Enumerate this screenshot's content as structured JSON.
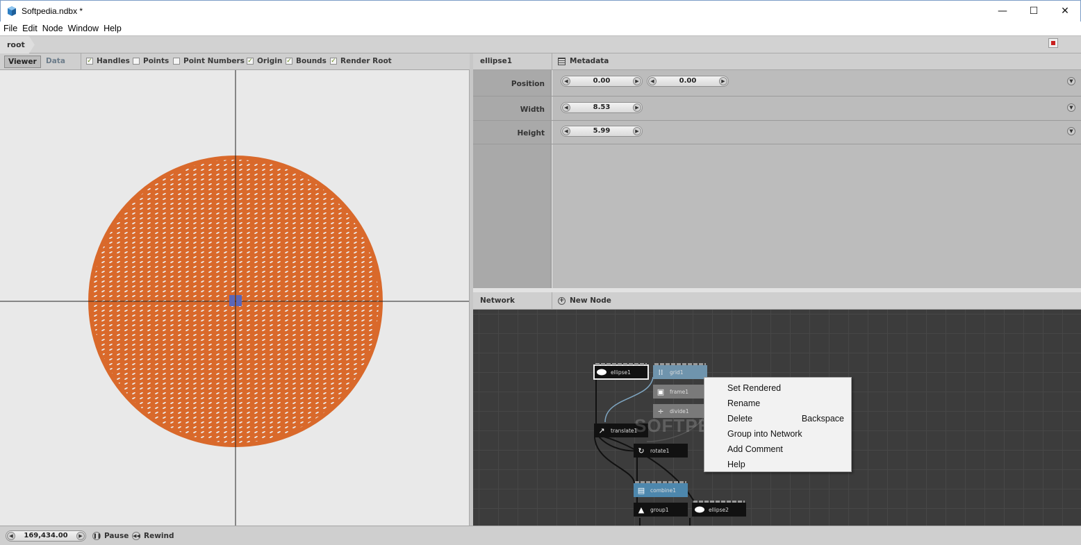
{
  "window": {
    "title": "Softpedia.ndbx *",
    "minimize": "—",
    "maximize": "☐",
    "close": "✕"
  },
  "menu": [
    "File",
    "Edit",
    "Node",
    "Window",
    "Help"
  ],
  "breadcrumb": {
    "root": "root"
  },
  "viewer": {
    "tabs": {
      "viewer": "Viewer",
      "data": "Data"
    },
    "options": [
      {
        "label": "Handles",
        "checked": true
      },
      {
        "label": "Points",
        "checked": false
      },
      {
        "label": "Point Numbers",
        "checked": false
      },
      {
        "label": "Origin",
        "checked": true
      },
      {
        "label": "Bounds",
        "checked": true
      },
      {
        "label": "Render Root",
        "checked": true
      }
    ],
    "shape_color": "#d9692b",
    "handle_color": "#5a66b8"
  },
  "parameters": {
    "node_name": "ellipse1",
    "metadata_label": "Metadata",
    "rows": [
      {
        "label": "Position",
        "values": [
          "0.00",
          "0.00"
        ]
      },
      {
        "label": "Width",
        "values": [
          "8.53"
        ]
      },
      {
        "label": "Height",
        "values": [
          "5.99"
        ]
      }
    ]
  },
  "network": {
    "title": "Network",
    "new_node": "New Node",
    "watermark": "SOFTPEDIA",
    "nodes": {
      "ellipse1": "ellipse1",
      "grid1": "grid1",
      "frame1": "frame1",
      "divide1": "divide1",
      "translate1": "translate1",
      "rotate1": "rotate1",
      "combine1": "combine1",
      "group1": "group1",
      "ellipse2": "ellipse2"
    }
  },
  "context_menu": {
    "items": [
      {
        "label": "Set Rendered",
        "shortcut": ""
      },
      {
        "label": "Rename",
        "shortcut": ""
      },
      {
        "label": "Delete",
        "shortcut": "Backspace"
      },
      {
        "label": "Group into Network",
        "shortcut": ""
      },
      {
        "label": "Add Comment",
        "shortcut": ""
      },
      {
        "label": "Help",
        "shortcut": ""
      }
    ]
  },
  "status": {
    "frame": "169,434.00",
    "pause": "Pause",
    "rewind": "Rewind"
  }
}
